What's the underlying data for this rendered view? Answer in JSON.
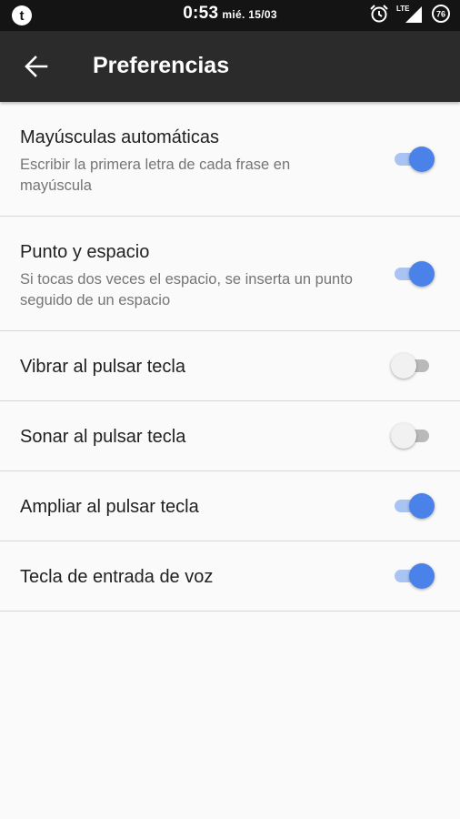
{
  "status_bar": {
    "time": "0:53",
    "date": "mié. 15/03",
    "network": "LTE",
    "battery": "76"
  },
  "app_bar": {
    "title": "Preferencias"
  },
  "preferences": [
    {
      "title": "Mayúsculas automáticas",
      "summary": "Escribir la primera letra de cada frase en mayúscula",
      "enabled": true
    },
    {
      "title": "Punto y espacio",
      "summary": "Si tocas dos veces el espacio, se inserta un punto seguido de un espacio",
      "enabled": true
    },
    {
      "title": "Vibrar al pulsar tecla",
      "enabled": false
    },
    {
      "title": "Sonar al pulsar tecla",
      "enabled": false
    },
    {
      "title": "Ampliar al pulsar tecla",
      "enabled": true
    },
    {
      "title": "Tecla de entrada de voz",
      "enabled": true
    }
  ],
  "colors": {
    "accent": "#4a82e9",
    "accent_track": "#a9c3f3",
    "app_bar": "#2b2b2b",
    "status_bar": "#141414"
  }
}
